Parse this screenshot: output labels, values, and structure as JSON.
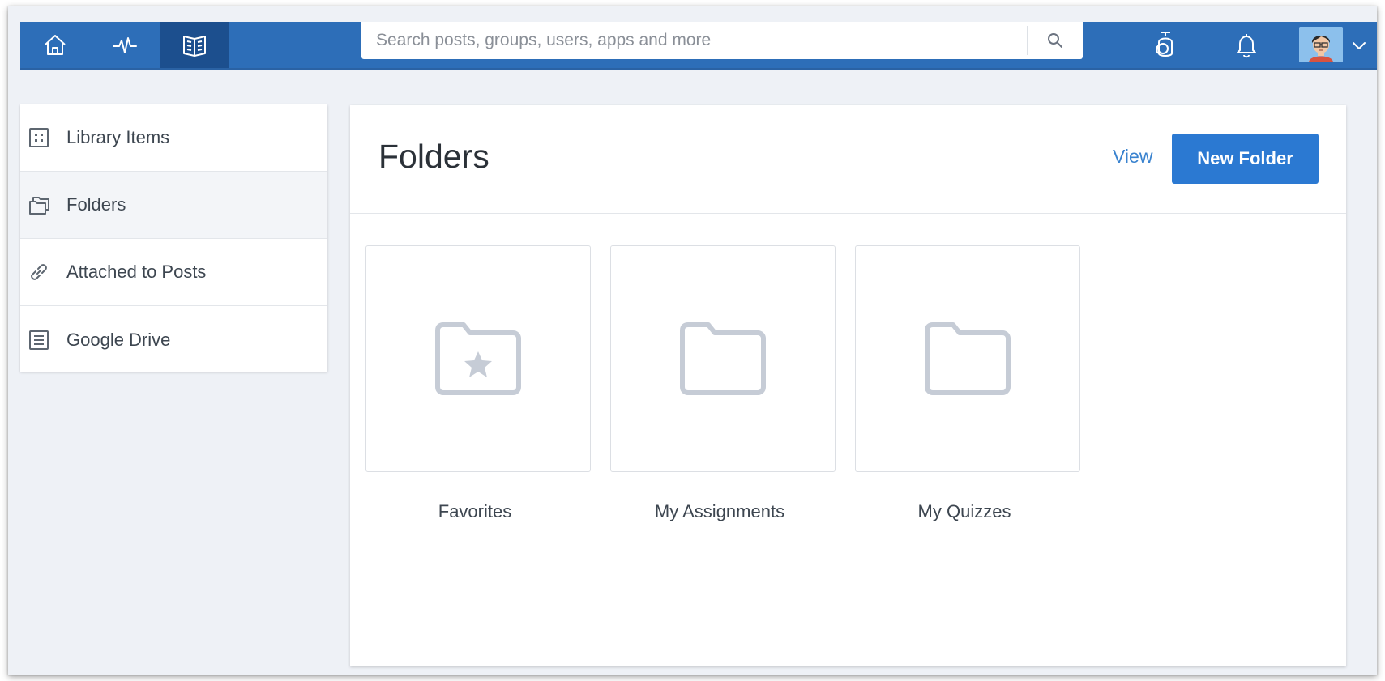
{
  "header": {
    "nav": [
      {
        "icon": "home-icon"
      },
      {
        "icon": "activity-icon"
      },
      {
        "icon": "library-icon",
        "active": true
      }
    ],
    "search": {
      "placeholder": "Search posts, groups, users, apps and more",
      "value": ""
    },
    "icons": [
      "search-icon",
      "backpack-icon",
      "bell-icon",
      "chevron-down-icon"
    ],
    "colors": {
      "bar": "#2d6eb8",
      "active": "#1c4f8e"
    }
  },
  "sidebar": {
    "items": [
      {
        "label": "Library Items",
        "icon": "grid-icon"
      },
      {
        "label": "Folders",
        "icon": "folders-icon",
        "active": true
      },
      {
        "label": "Attached to Posts",
        "icon": "link-icon"
      },
      {
        "label": "Google Drive",
        "icon": "document-icon"
      }
    ]
  },
  "main": {
    "title": "Folders",
    "view_label": "View",
    "new_folder_label": "New Folder",
    "folders": [
      {
        "label": "Favorites",
        "icon": "star-folder-icon"
      },
      {
        "label": "My Assignments",
        "icon": "folder-icon"
      },
      {
        "label": "My Quizzes",
        "icon": "folder-icon"
      }
    ],
    "colors": {
      "accent": "#2b79d2",
      "link": "#3a83cf",
      "folder_icon": "#c6ccd6"
    }
  }
}
